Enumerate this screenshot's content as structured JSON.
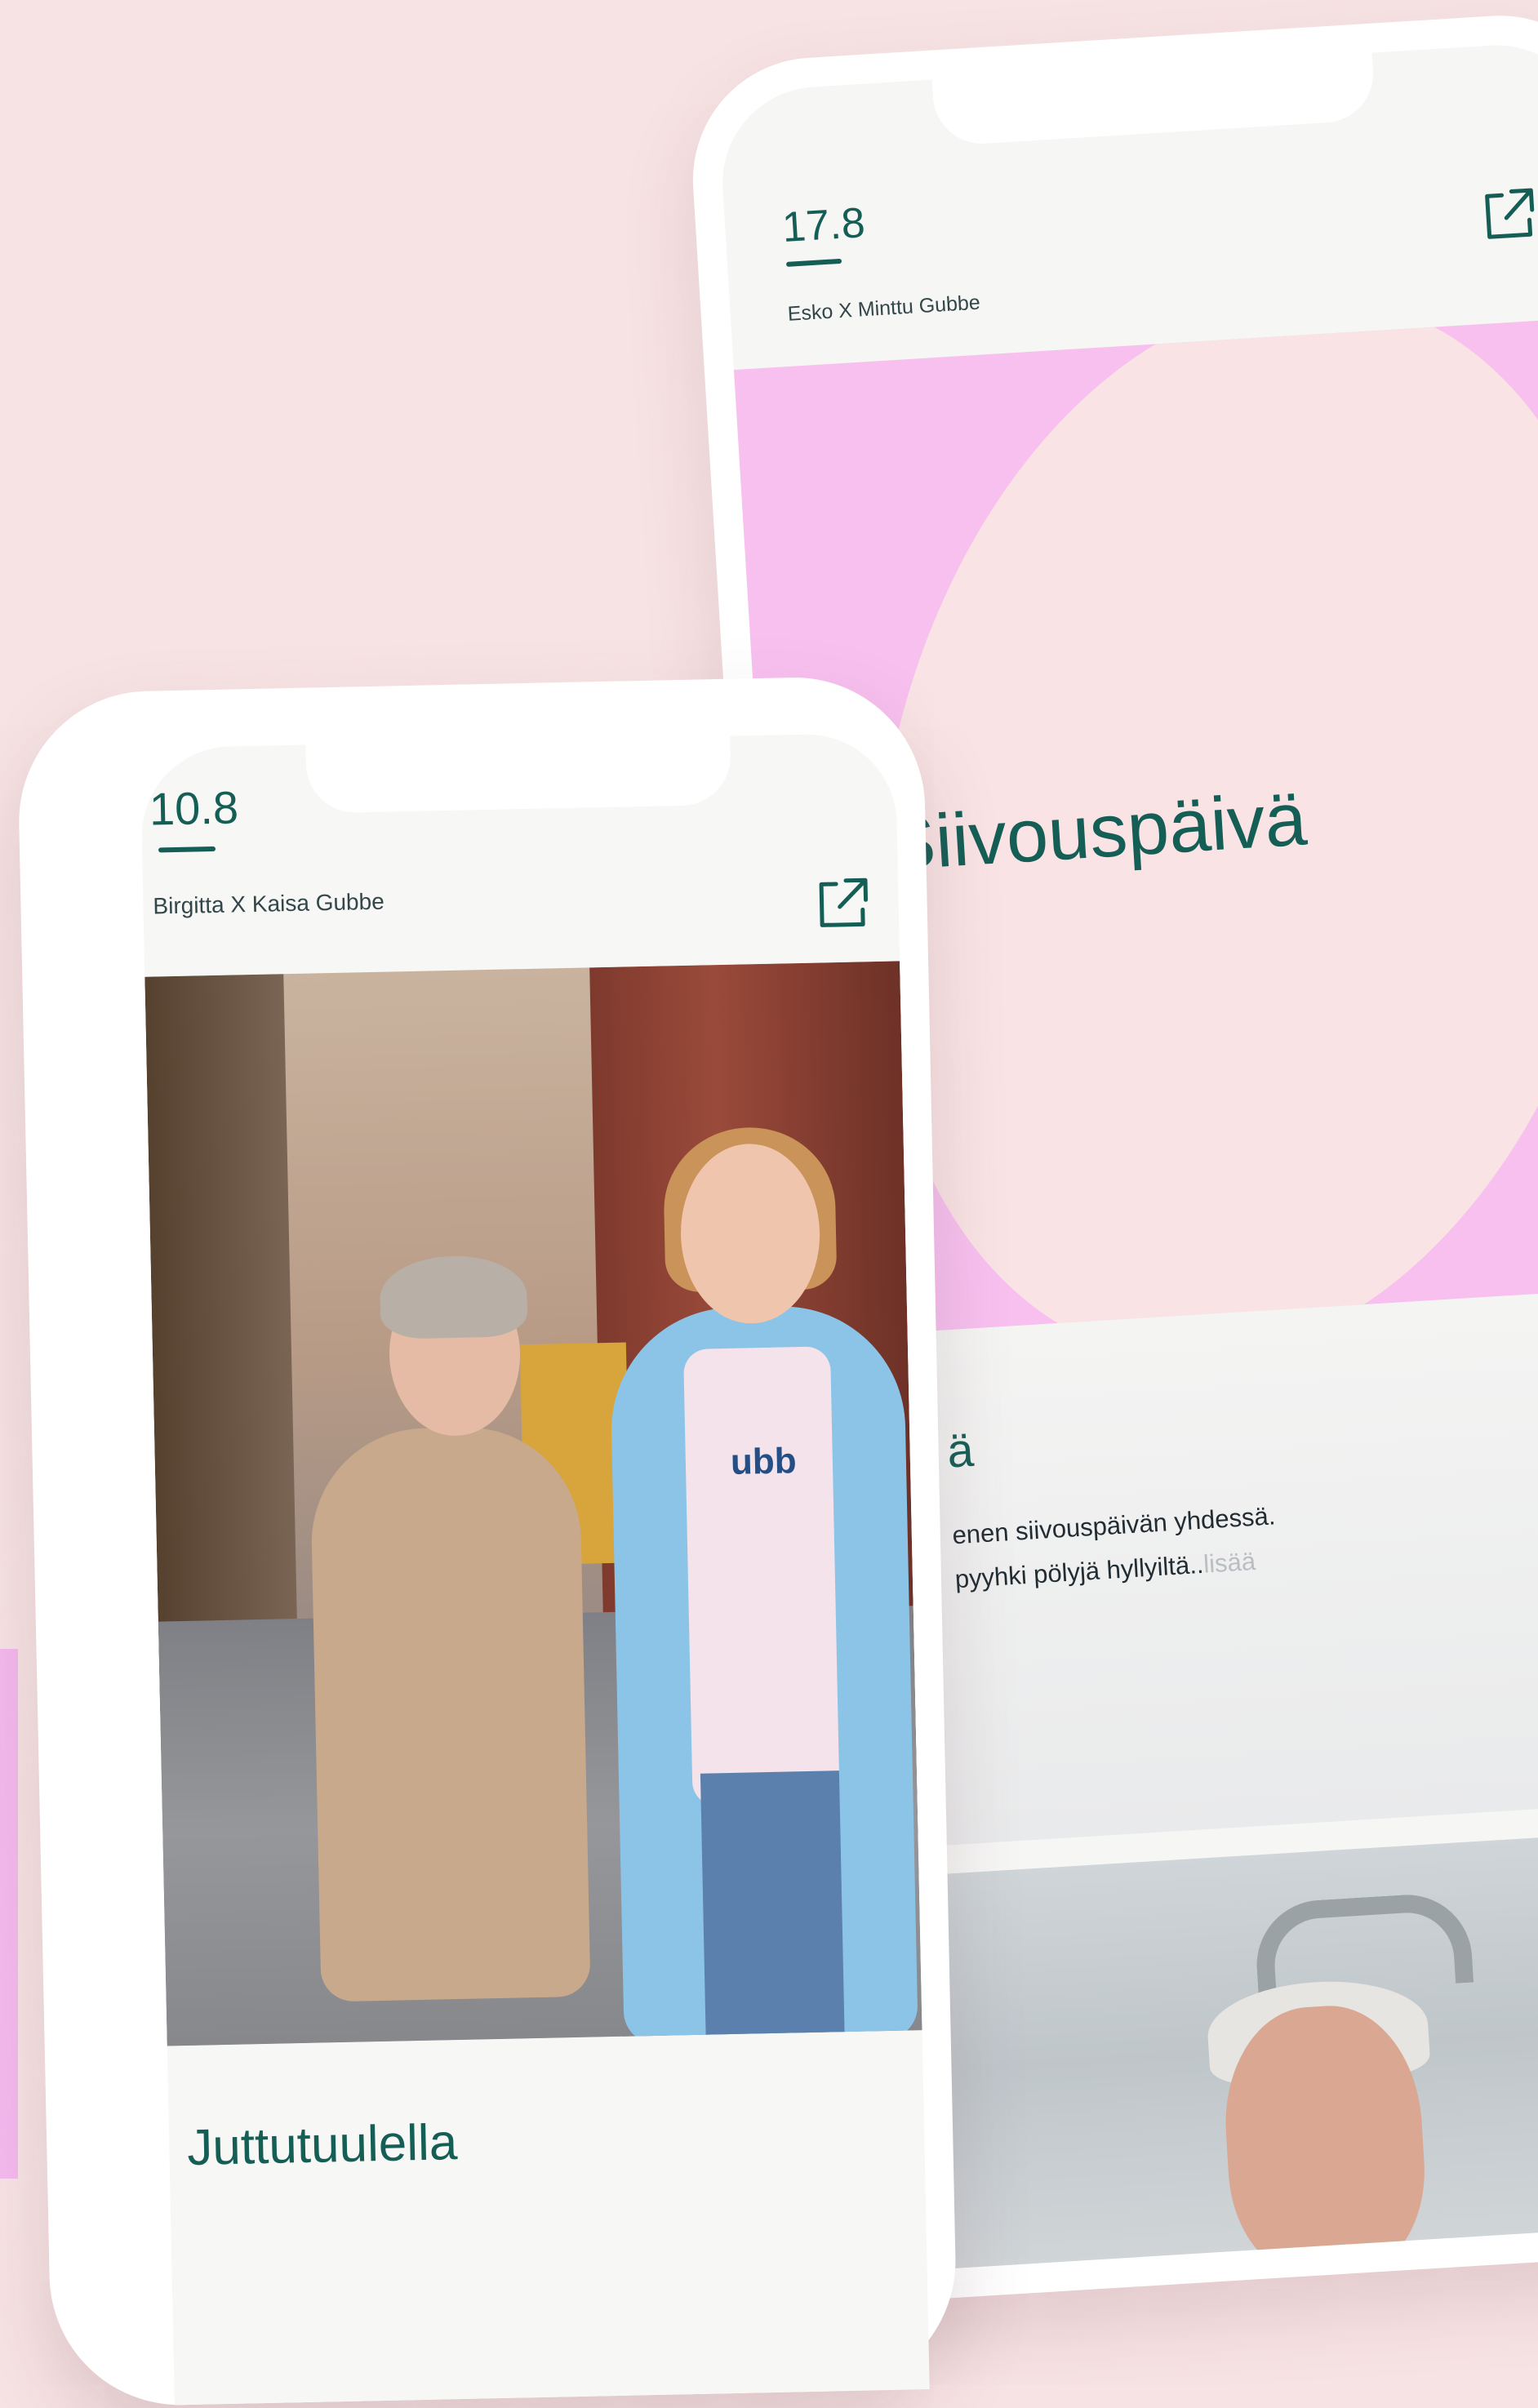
{
  "back_card": {
    "date": "17.8",
    "pair": "Esko X Minttu Gubbe",
    "hero_title": "Siivouspäivä",
    "heading": "ä",
    "text_line1": "enen siivouspäivän yhdessä.",
    "text_line2": "pyyhki pölyjä hyllyiltä..",
    "more_link": "lisää",
    "share_icon": "external-link-icon"
  },
  "front_card": {
    "date": "10.8",
    "pair": "Birgitta X Kaisa Gubbe",
    "photo_shirt_print": "ubb",
    "title": "Juttutuulella",
    "share_icon": "external-link-icon"
  },
  "colors": {
    "background": "#f7e3e4",
    "accent_green": "#155e55",
    "hero_pink": "#f7c0ef",
    "card_surface": "#f6f6f5"
  }
}
